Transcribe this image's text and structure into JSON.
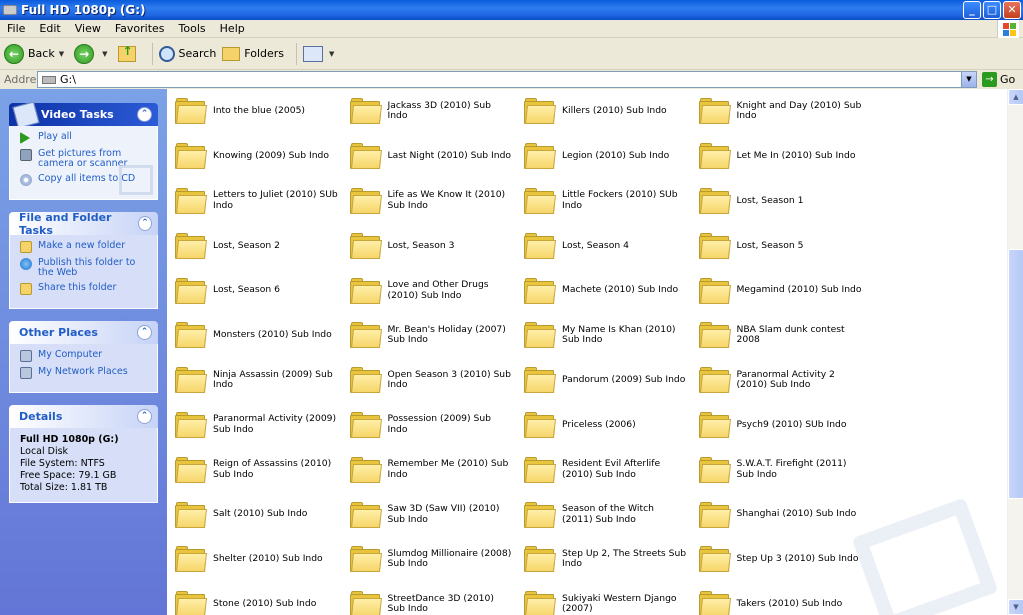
{
  "window": {
    "title": "Full HD 1080p (G:)",
    "buttons": {
      "minimize": "_",
      "maximize": "□",
      "close": "✕"
    }
  },
  "menu": {
    "items": [
      "File",
      "Edit",
      "View",
      "Favorites",
      "Tools",
      "Help"
    ]
  },
  "toolbar": {
    "back_label": "Back",
    "search_label": "Search",
    "folders_label": "Folders"
  },
  "address": {
    "label": "Address",
    "value": "G:\\",
    "go_label": "Go"
  },
  "tasks": {
    "video": {
      "title": "Video Tasks",
      "items": [
        "Play all",
        "Get pictures from camera or scanner",
        "Copy all items to CD"
      ]
    },
    "file_folder": {
      "title": "File and Folder Tasks",
      "items": [
        "Make a new folder",
        "Publish this folder to the Web",
        "Share this folder"
      ]
    },
    "other_places": {
      "title": "Other Places",
      "items": [
        "My Computer",
        "My Network Places"
      ]
    },
    "details": {
      "title": "Details",
      "name": "Full HD 1080p (G:)",
      "type": "Local Disk",
      "filesystem": "File System: NTFS",
      "free": "Free Space: 79.1 GB",
      "total": "Total Size: 1.81 TB"
    }
  },
  "folders": [
    "Into the blue (2005)",
    "Jackass 3D (2010) Sub Indo",
    "Killers (2010) Sub Indo",
    "Knight and Day (2010) Sub Indo",
    "Knowing (2009) Sub Indo",
    "Last Night (2010) Sub Indo",
    "Legion (2010) Sub Indo",
    "Let Me In (2010) Sub Indo",
    "Letters to Juliet (2010) SUb Indo",
    "Life as We Know It (2010) Sub Indo",
    "Little Fockers (2010) SUb Indo",
    "Lost, Season 1",
    "Lost, Season 2",
    "Lost, Season 3",
    "Lost, Season 4",
    "Lost, Season 5",
    "Lost, Season 6",
    "Love and Other Drugs (2010) Sub Indo",
    "Machete (2010) Sub Indo",
    "Megamind (2010) Sub Indo",
    "Monsters (2010) Sub Indo",
    "Mr. Bean's Holiday (2007) Sub Indo",
    "My Name Is Khan (2010) Sub Indo",
    "NBA Slam dunk contest 2008",
    "Ninja Assassin (2009) Sub Indo",
    "Open Season 3 (2010) Sub Indo",
    "Pandorum (2009) Sub Indo",
    "Paranormal Activity 2 (2010) Sub Indo",
    "Paranormal Activity (2009) Sub Indo",
    "Possession (2009) Sub Indo",
    "Priceless (2006)",
    "Psych9 (2010) SUb Indo",
    "Reign of Assassins (2010) Sub Indo",
    "Remember Me (2010) Sub Indo",
    "Resident Evil Afterlife (2010) Sub Indo",
    "S.W.A.T. Firefight (2011) Sub Indo",
    "Salt (2010) Sub Indo",
    "Saw 3D (Saw VII) (2010) Sub Indo",
    "Season of the Witch (2011) Sub Indo",
    "Shanghai (2010) Sub Indo",
    "Shelter (2010) Sub Indo",
    "Slumdog Millionaire (2008) Sub Indo",
    "Step Up 2, The Streets Sub Indo",
    "Step Up 3 (2010) Sub Indo",
    "Stone (2010) Sub Indo",
    "StreetDance 3D (2010) Sub Indo",
    "Sukiyaki Western Django (2007)",
    "Takers (2010) Sub Indo"
  ]
}
